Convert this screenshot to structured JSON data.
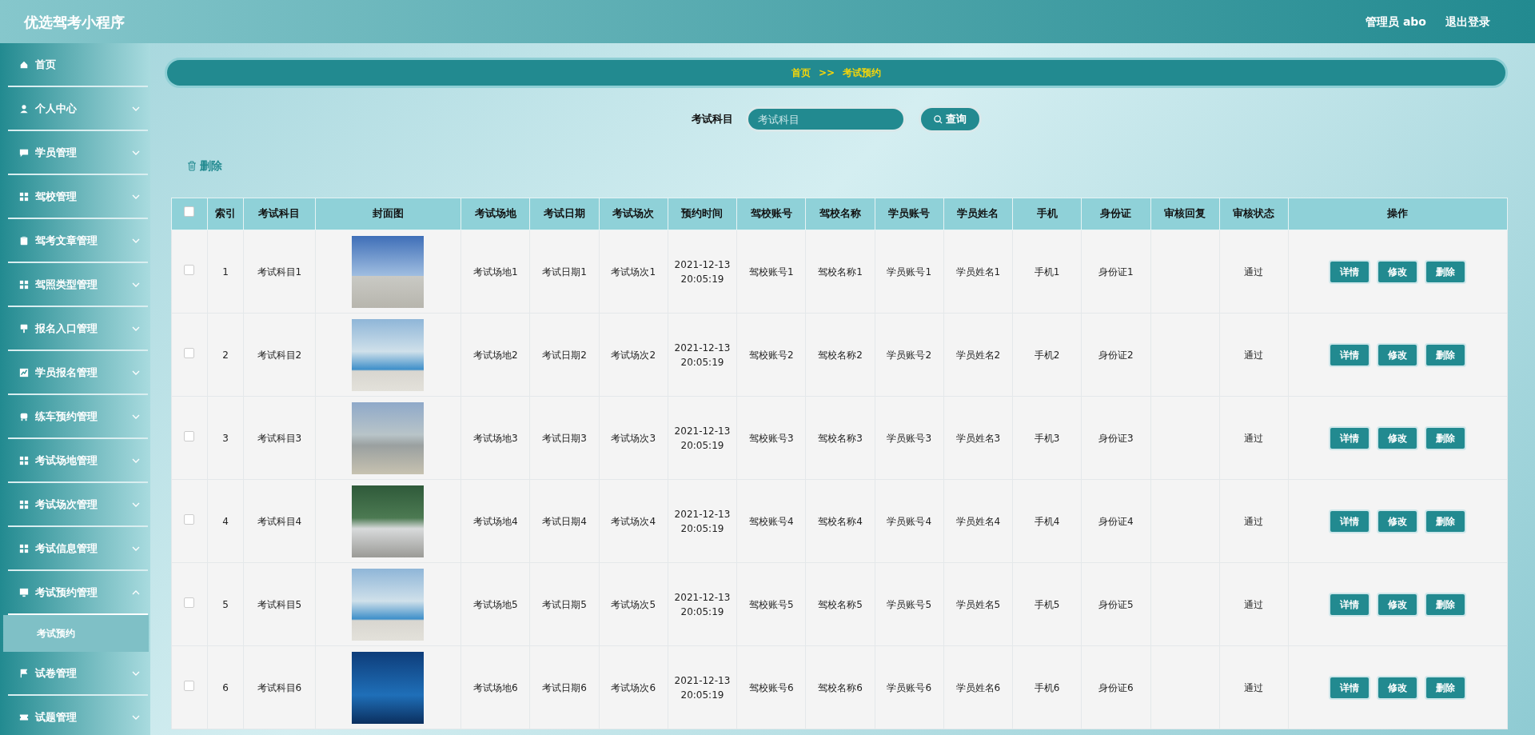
{
  "app_title": "优选驾考小程序",
  "header": {
    "user": "管理员 abo",
    "logout": "退出登录"
  },
  "sidebar": {
    "items": [
      {
        "label": "首页",
        "kind": "link"
      },
      {
        "label": "个人中心",
        "kind": "menu",
        "expanded": false
      },
      {
        "label": "学员管理",
        "kind": "menu",
        "expanded": false
      },
      {
        "label": "驾校管理",
        "kind": "menu",
        "expanded": false
      },
      {
        "label": "驾考文章管理",
        "kind": "menu",
        "expanded": false
      },
      {
        "label": "驾照类型管理",
        "kind": "menu",
        "expanded": false
      },
      {
        "label": "报名入口管理",
        "kind": "menu",
        "expanded": false
      },
      {
        "label": "学员报名管理",
        "kind": "menu",
        "expanded": false
      },
      {
        "label": "练车预约管理",
        "kind": "menu",
        "expanded": false
      },
      {
        "label": "考试场地管理",
        "kind": "menu",
        "expanded": false
      },
      {
        "label": "考试场次管理",
        "kind": "menu",
        "expanded": false
      },
      {
        "label": "考试信息管理",
        "kind": "menu",
        "expanded": false
      },
      {
        "label": "考试预约管理",
        "kind": "menu",
        "expanded": true,
        "children": [
          {
            "label": "考试预约",
            "selected": true
          }
        ]
      },
      {
        "label": "试卷管理",
        "kind": "menu",
        "expanded": false
      },
      {
        "label": "试题管理",
        "kind": "menu",
        "expanded": false
      }
    ]
  },
  "breadcrumb": {
    "items": [
      "首页",
      "考试预约"
    ],
    "separator": ">>"
  },
  "search": {
    "label": "考试科目",
    "placeholder": "考试科目",
    "button": "查询"
  },
  "toolbar": {
    "delete": "删除"
  },
  "table": {
    "header_checked": false,
    "columns": [
      "索引",
      "考试科目",
      "封面图",
      "考试场地",
      "考试日期",
      "考试场次",
      "预约时间",
      "驾校账号",
      "驾校名称",
      "学员账号",
      "学员姓名",
      "手机",
      "身份证",
      "审核回复",
      "审核状态",
      "操作"
    ],
    "rows": [
      {
        "checked": false,
        "index": "1",
        "subject": "考试科目1",
        "venue": "考试场地1",
        "date": "考试日期1",
        "session": "考试场次1",
        "time": "2021-12-13 20:05:19",
        "school_account": "驾校账号1",
        "school_name": "驾校名称1",
        "student_account": "学员账号1",
        "student_name": "学员姓名1",
        "phone": "手机1",
        "id_card": "身份证1",
        "status": "通过",
        "actions": [
          "详情",
          "修改",
          "删除"
        ]
      },
      {
        "checked": false,
        "index": "2",
        "subject": "考试科目2",
        "venue": "考试场地2",
        "date": "考试日期2",
        "session": "考试场次2",
        "time": "2021-12-13 20:05:19",
        "school_account": "驾校账号2",
        "school_name": "驾校名称2",
        "student_account": "学员账号2",
        "student_name": "学员姓名2",
        "phone": "手机2",
        "id_card": "身份证2",
        "status": "通过",
        "actions": [
          "详情",
          "修改",
          "删除"
        ]
      },
      {
        "checked": false,
        "index": "3",
        "subject": "考试科目3",
        "venue": "考试场地3",
        "date": "考试日期3",
        "session": "考试场次3",
        "time": "2021-12-13 20:05:19",
        "school_account": "驾校账号3",
        "school_name": "驾校名称3",
        "student_account": "学员账号3",
        "student_name": "学员姓名3",
        "phone": "手机3",
        "id_card": "身份证3",
        "status": "通过",
        "actions": [
          "详情",
          "修改",
          "删除"
        ]
      },
      {
        "checked": false,
        "index": "4",
        "subject": "考试科目4",
        "venue": "考试场地4",
        "date": "考试日期4",
        "session": "考试场次4",
        "time": "2021-12-13 20:05:19",
        "school_account": "驾校账号4",
        "school_name": "驾校名称4",
        "student_account": "学员账号4",
        "student_name": "学员姓名4",
        "phone": "手机4",
        "id_card": "身份证4",
        "status": "通过",
        "actions": [
          "详情",
          "修改",
          "删除"
        ]
      },
      {
        "checked": false,
        "index": "5",
        "subject": "考试科目5",
        "venue": "考试场地5",
        "date": "考试日期5",
        "session": "考试场次5",
        "time": "2021-12-13 20:05:19",
        "school_account": "驾校账号5",
        "school_name": "驾校名称5",
        "student_account": "学员账号5",
        "student_name": "学员姓名5",
        "phone": "手机5",
        "id_card": "身份证5",
        "status": "通过",
        "actions": [
          "详情",
          "修改",
          "删除"
        ]
      },
      {
        "checked": false,
        "index": "6",
        "subject": "考试科目6",
        "venue": "考试场地6",
        "date": "考试日期6",
        "session": "考试场次6",
        "time": "2021-12-13 20:05:19",
        "school_account": "驾校账号6",
        "school_name": "驾校名称6",
        "student_account": "学员账号6",
        "student_name": "学员姓名6",
        "phone": "手机6",
        "id_card": "身份证6",
        "status": "通过",
        "actions": [
          "详情",
          "修改",
          "删除"
        ]
      }
    ]
  }
}
